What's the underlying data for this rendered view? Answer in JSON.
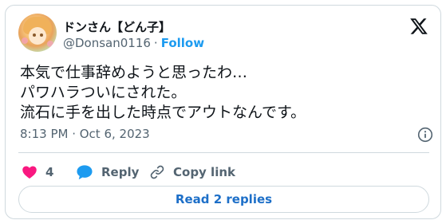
{
  "tweet": {
    "author": {
      "display_name": "ドンさん【どん子】",
      "handle": "@Donsan0116",
      "follow_label": "Follow"
    },
    "text": "本気で仕事辞めようと思ったわ…\nパワハラついにされた。\n流石に手を出した時点でアウトなんです。",
    "timestamp": "8:13 PM · Oct 6, 2023",
    "actions": {
      "like_count": "4",
      "reply_label": "Reply",
      "copy_link_label": "Copy link"
    },
    "read_replies_label": "Read 2 replies"
  },
  "colors": {
    "like": "#f91880",
    "reply": "#1d9bf0",
    "link": "#1d6fc8",
    "muted": "#536471",
    "border": "#cfd9de"
  },
  "icons": {
    "brand": "x-logo-icon",
    "info": "info-icon",
    "like": "heart-icon",
    "reply": "speech-bubble-icon",
    "copy": "link-icon"
  }
}
